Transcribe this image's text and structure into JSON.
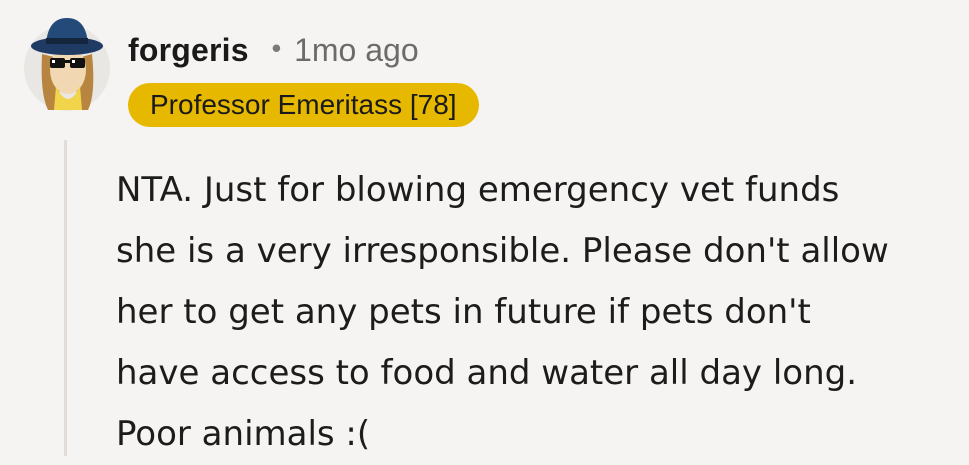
{
  "comment": {
    "author": "forgeris",
    "separator": "•",
    "timestamp": "1mo ago",
    "flair": {
      "text": "Professor Emeritass [78]",
      "color": "#e6b800"
    },
    "avatar_icon": "user-avatar-icon",
    "body_lines": [
      "NTA. Just for blowing emergency vet funds",
      "she is a very irresponsible. Please don't allow",
      "her to get any pets in future if pets don't",
      "have access to food and water all day long.",
      "Poor animals :("
    ]
  }
}
